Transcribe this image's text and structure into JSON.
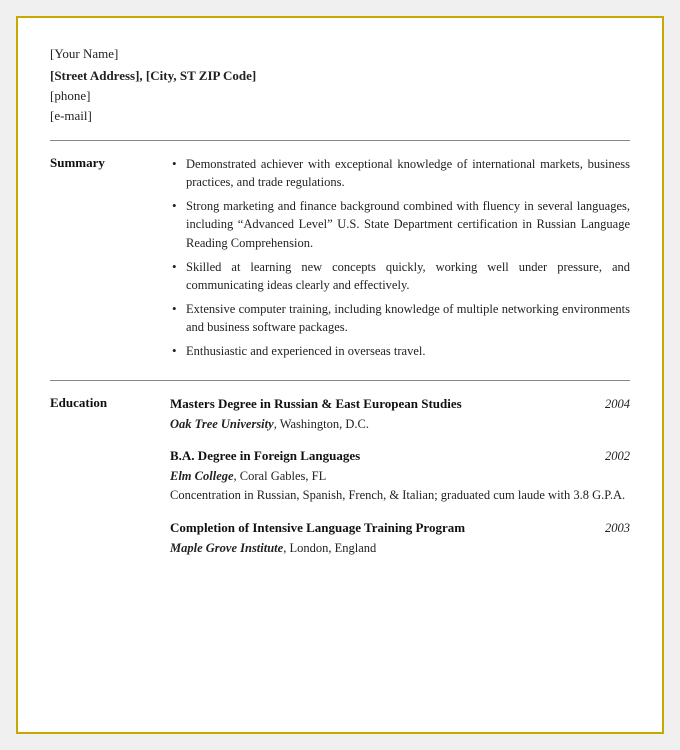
{
  "header": {
    "name": "[Your Name]",
    "address": "[Street Address], [City, ST  ZIP Code]",
    "phone": "[phone]",
    "email": "[e-mail]"
  },
  "summary": {
    "label": "Summary",
    "bullets": [
      "Demonstrated achiever with exceptional knowledge of international markets, business practices, and trade regulations.",
      "Strong marketing and finance background combined with fluency in several languages, including “Advanced Level” U.S. State Department certification in Russian Language Reading Comprehension.",
      "Skilled at learning new concepts quickly, working well under pressure, and communicating ideas clearly and effectively.",
      "Extensive computer training, including knowledge of multiple networking environments and business software packages.",
      "Enthusiastic and experienced in overseas travel."
    ]
  },
  "education": {
    "label": "Education",
    "entries": [
      {
        "degree": "Masters Degree in Russian & East European Studies",
        "year": "2004",
        "school_name": "Oak Tree University",
        "school_location": ", Washington, D.C.",
        "details": ""
      },
      {
        "degree": "B.A. Degree in Foreign Languages",
        "year": "2002",
        "school_name": "Elm College",
        "school_location": ", Coral Gables, FL",
        "details": "Concentration in Russian, Spanish, French, & Italian; graduated cum laude with 3.8 G.P.A."
      },
      {
        "degree": "Completion of Intensive Language Training Program",
        "year": "2003",
        "school_name": "Maple Grove Institute",
        "school_location": ", London, England",
        "details": ""
      }
    ]
  }
}
